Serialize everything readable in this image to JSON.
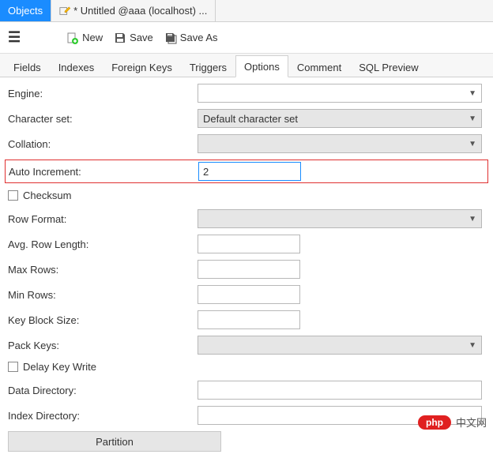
{
  "topTabs": {
    "objects": "Objects",
    "untitled": "* Untitled @aaa (localhost) ..."
  },
  "toolbar": {
    "new": "New",
    "save": "Save",
    "saveAs": "Save As"
  },
  "subtabs": {
    "fields": "Fields",
    "indexes": "Indexes",
    "foreignKeys": "Foreign Keys",
    "triggers": "Triggers",
    "options": "Options",
    "comment": "Comment",
    "sqlPreview": "SQL Preview"
  },
  "form": {
    "engine": {
      "label": "Engine:",
      "value": ""
    },
    "charset": {
      "label": "Character set:",
      "value": "Default character set"
    },
    "collation": {
      "label": "Collation:",
      "value": ""
    },
    "autoIncrement": {
      "label": "Auto Increment:",
      "value": "2"
    },
    "checksum": "Checksum",
    "rowFormat": {
      "label": "Row Format:",
      "value": ""
    },
    "avgRowLength": {
      "label": "Avg. Row Length:",
      "value": ""
    },
    "maxRows": {
      "label": "Max Rows:",
      "value": ""
    },
    "minRows": {
      "label": "Min Rows:",
      "value": ""
    },
    "keyBlockSize": {
      "label": "Key Block Size:",
      "value": ""
    },
    "packKeys": {
      "label": "Pack Keys:",
      "value": ""
    },
    "delayKeyWrite": "Delay Key Write",
    "dataDirectory": {
      "label": "Data Directory:",
      "value": ""
    },
    "indexDirectory": {
      "label": "Index Directory:",
      "value": ""
    },
    "partition": "Partition"
  },
  "watermark": {
    "pill": "php",
    "text": "中文网"
  }
}
